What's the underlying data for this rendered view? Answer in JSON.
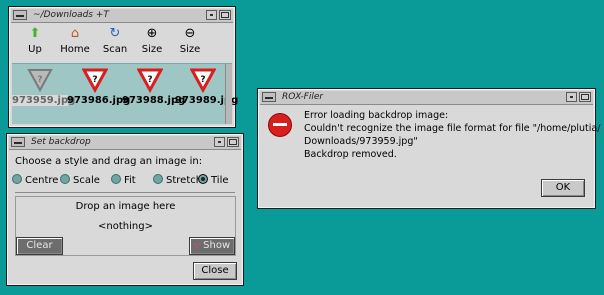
{
  "filer": {
    "title": "~/Downloads +T",
    "toolbar": [
      {
        "label": "Up",
        "icon": "up-arrow-icon",
        "glyph": "⬆",
        "color": "#4caf2a"
      },
      {
        "label": "Home",
        "icon": "home-icon",
        "glyph": "⌂",
        "color": "#b85a1a"
      },
      {
        "label": "Scan",
        "icon": "refresh-icon",
        "glyph": "↻",
        "color": "#2a5fb8"
      },
      {
        "label": "Size",
        "icon": "zoom-in-icon",
        "glyph": "⊕",
        "color": "#333333"
      },
      {
        "label": "Size",
        "icon": "zoom-out-icon",
        "glyph": "⊖",
        "color": "#333333"
      }
    ],
    "files": [
      {
        "name": "973959.jpg",
        "selected": true
      },
      {
        "name": "973986.jpg",
        "selected": false
      },
      {
        "name": "973988.jpg",
        "selected": false
      },
      {
        "name": "973989.jpg",
        "selected": false
      }
    ]
  },
  "backdrop": {
    "title": "Set backdrop",
    "instruction": "Choose a style and drag an image in:",
    "styles": [
      {
        "label": "Centre",
        "selected": false
      },
      {
        "label": "Scale",
        "selected": false
      },
      {
        "label": "Fit",
        "selected": false
      },
      {
        "label": "Stretch",
        "selected": false
      },
      {
        "label": "Tile",
        "selected": true
      }
    ],
    "drop_text": "Drop an image here",
    "current": "<nothing>",
    "clear_label": "Clear",
    "show_label": "Show",
    "close_label": "Close"
  },
  "error": {
    "title": "ROX-Filer",
    "lines": [
      "Error loading backdrop image:",
      "Couldn't recognize the image file format for file \"/home/plutia/",
      "Downloads/973959.jpg\"",
      "Backdrop removed."
    ],
    "ok_label": "OK"
  },
  "colors": {
    "desktop": "#0a9a98",
    "window": "#d9d9d9",
    "warning_red": "#d81e1e"
  }
}
